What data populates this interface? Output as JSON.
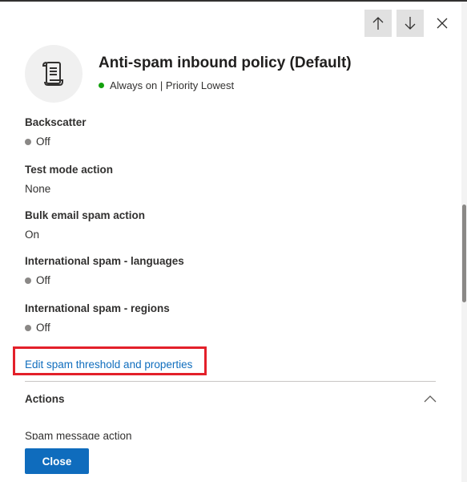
{
  "header": {
    "title": "Anti-spam inbound policy (Default)",
    "status": "Always on | Priority Lowest",
    "status_color": "#13a10e",
    "icon": "scroll-policy-icon"
  },
  "nav": {
    "up_icon": "arrow-up-icon",
    "down_icon": "arrow-down-icon",
    "close_icon": "close-icon"
  },
  "fields": [
    {
      "label": "Backscatter",
      "value": "Off",
      "dot": true
    },
    {
      "label": "Test mode action",
      "value": "None",
      "dot": false
    },
    {
      "label": "Bulk email spam action",
      "value": "On",
      "dot": false
    },
    {
      "label": "International spam - languages",
      "value": "Off",
      "dot": true
    },
    {
      "label": "International spam - regions",
      "value": "Off",
      "dot": true
    }
  ],
  "edit_link": "Edit spam threshold and properties",
  "highlight_color": "#e3202a",
  "actions_section": {
    "title": "Actions",
    "partial_item": "Spam message action"
  },
  "footer": {
    "close_label": "Close"
  }
}
